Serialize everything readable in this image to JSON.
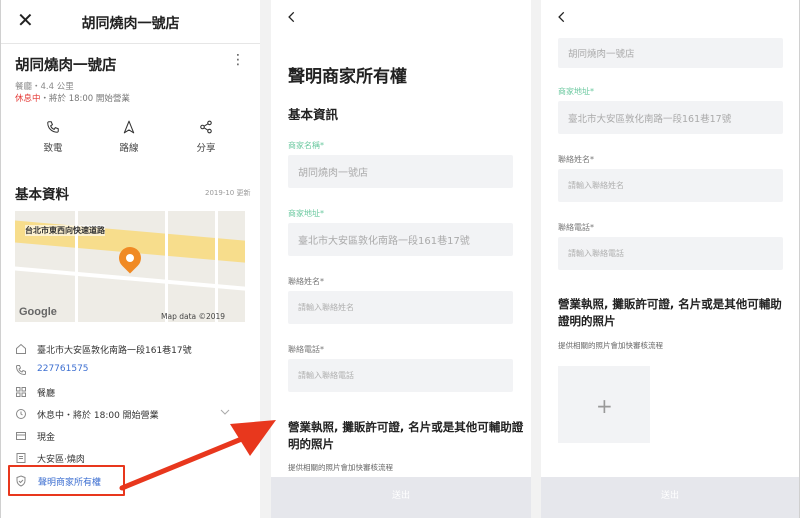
{
  "panel1": {
    "header_title": "胡同燒肉一號店",
    "business_name": "胡同燒肉一號店",
    "category": "餐廳・4.4 公里",
    "status_closed": "休息中",
    "status_rest": "・將於 18:00 開始營業",
    "actions": [
      {
        "label": "致電",
        "icon": "phone-icon"
      },
      {
        "label": "路線",
        "icon": "navigation-icon"
      },
      {
        "label": "分享",
        "icon": "share-icon"
      }
    ],
    "section_title": "基本資料",
    "updated": "2019-10 更新",
    "map": {
      "street_label": "台北市東西向快速道路",
      "logo": "Google",
      "credit": "Map data ©2019 Google"
    },
    "info": {
      "address": "臺北市大安區敦化南路一段161巷17號",
      "phone": "227761575",
      "category": "餐廳",
      "hours": "休息中・將於 18:00 開始營業",
      "payment": "現金",
      "tags": "大安區·燒肉",
      "claim": "聲明商家所有權"
    }
  },
  "panel2": {
    "title": "聲明商家所有權",
    "section_basic": "基本資訊",
    "fields": [
      {
        "label": "商家名稱*",
        "value": "胡同燒肉一號店",
        "required_green": true
      },
      {
        "label": "商家地址*",
        "value": "臺北市大安區敦化南路一段161巷17號",
        "required_green": true
      },
      {
        "label": "聯絡姓名*",
        "placeholder": "請輸入聯絡姓名"
      },
      {
        "label": "聯絡電話*",
        "placeholder": "請輸入聯絡電話"
      }
    ],
    "upload_title": "營業執照, 攤販許可證, 名片或是其他可輔助證明的照片",
    "upload_hint": "提供相關的照片會加快審核流程",
    "submit": "送出"
  },
  "panel3": {
    "name_value": "胡同燒肉一號店",
    "address_label": "商家地址*",
    "address_value": "臺北市大安區敦化南路一段161巷17號",
    "contact_label": "聯絡姓名*",
    "contact_placeholder": "請輸入聯絡姓名",
    "phone_label": "聯絡電話*",
    "phone_placeholder": "請輸入聯絡電話",
    "upload_title": "營業執照, 攤販許可證, 名片或是其他可輔助證明的照片",
    "upload_hint": "提供相關的照片會加快審核流程",
    "upload_plus": "+",
    "submit": "送出"
  },
  "colors": {
    "accent_link": "#3d6fd1",
    "status_red": "#e53935",
    "required_green": "#6cc9a0",
    "highlight_red": "#e8371d",
    "pin_orange": "#f08a24"
  }
}
